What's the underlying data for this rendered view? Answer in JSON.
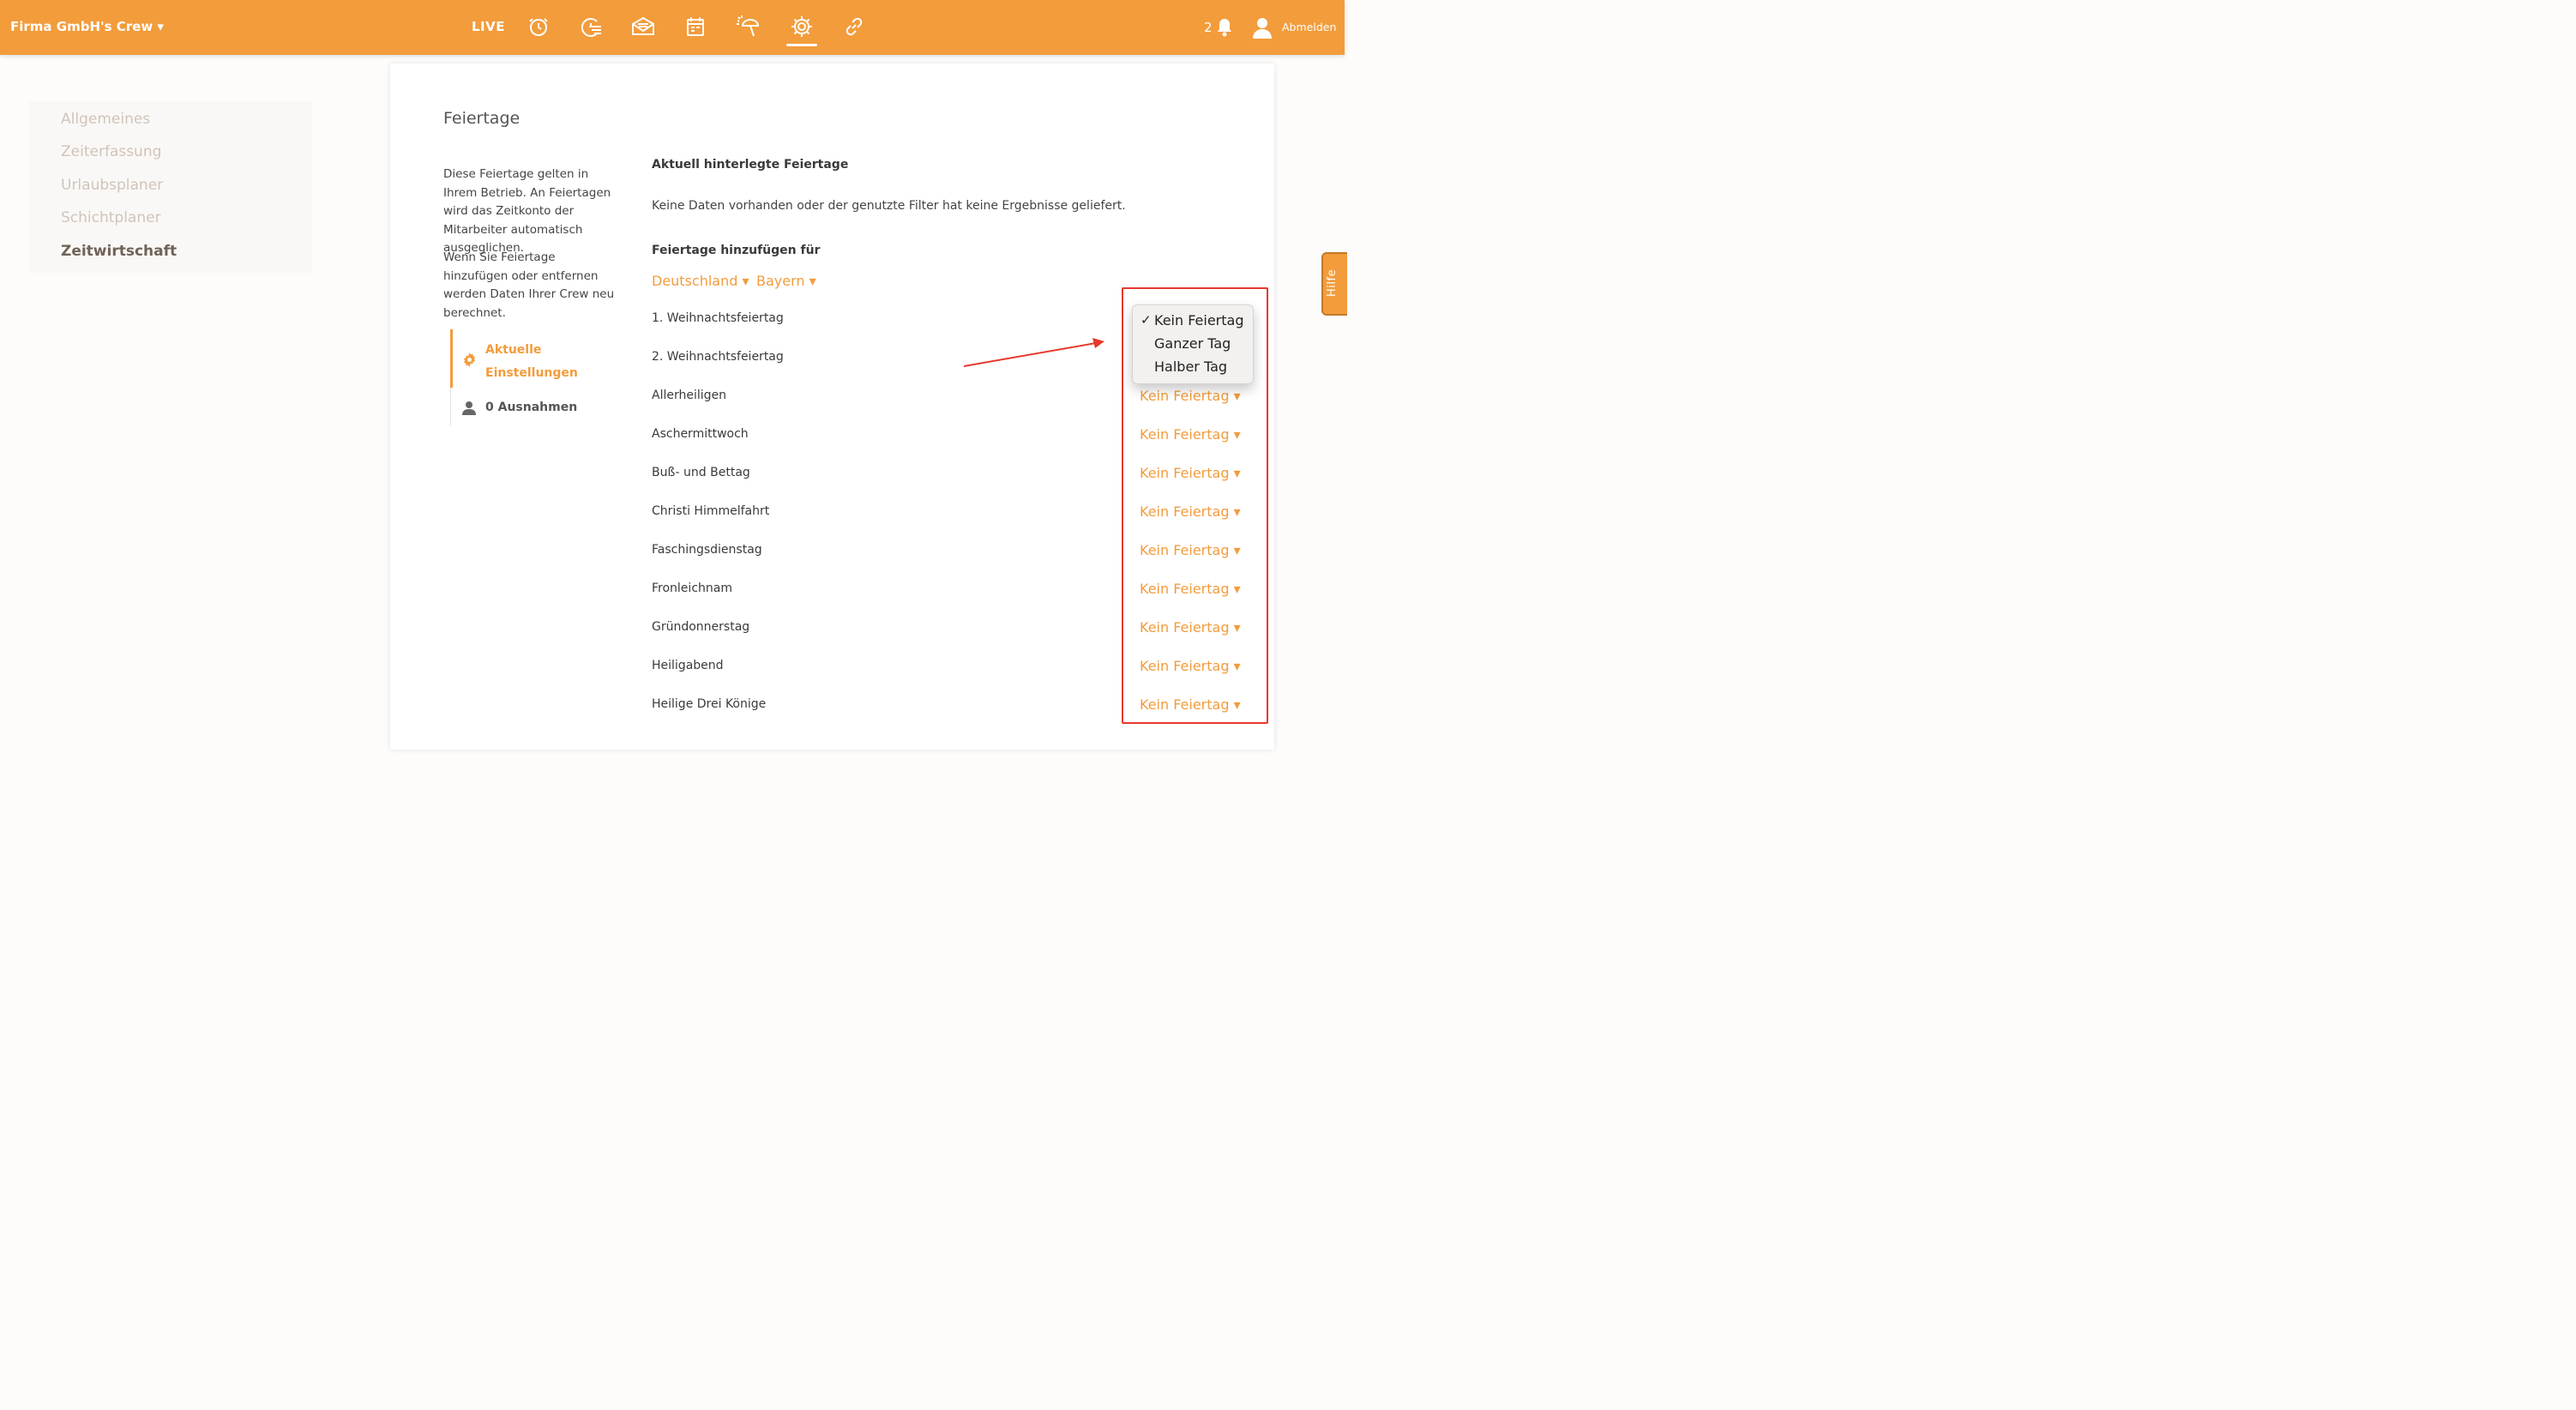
{
  "header": {
    "crew_label": "Firma GmbH's Crew ▾",
    "live_label": "LIVE",
    "nav_icons": [
      "clock-icon",
      "timesheet-icon",
      "inbox-icon",
      "calendar-icon",
      "vacation-umbrella-icon",
      "settings-gear-icon",
      "link-icon"
    ],
    "active_nav": "settings-gear-icon",
    "notification_count": "2",
    "logout_label": "Abmelden"
  },
  "sidebar": {
    "items": [
      {
        "label": "Allgemeines"
      },
      {
        "label": "Zeiterfassung"
      },
      {
        "label": "Urlaubsplaner"
      },
      {
        "label": "Schichtplaner"
      },
      {
        "label": "Zeitwirtschaft"
      }
    ],
    "active": "Zeitwirtschaft"
  },
  "main": {
    "title": "Feiertage",
    "description_1": "Diese Feiertage gelten in Ihrem Betrieb. An Feiertagen wird das Zeitkonto der Mitarbeiter automatisch ausgeglichen.",
    "description_2": "Wenn Sie Feiertage hinzufügen oder entfernen werden Daten Ihrer Crew neu berechnet.",
    "subnav": {
      "active_label": "Aktuelle Einstellungen",
      "other_label": "0 Ausnahmen"
    },
    "current_heading": "Aktuell hinterlegte Feiertage",
    "no_data_text": "Keine Daten vorhanden oder der genutzte Filter hat keine Ergebnisse geliefert.",
    "add_heading": "Feiertage hinzufügen für",
    "country_filter": "Deutschland ▾",
    "region_filter": "Bayern ▾",
    "holidays": [
      {
        "name": "1. Weihnachtsfeiertag",
        "value": ""
      },
      {
        "name": "2. Weihnachtsfeiertag",
        "value": ""
      },
      {
        "name": "Allerheiligen",
        "value": "Kein Feiertag ▾"
      },
      {
        "name": "Aschermittwoch",
        "value": "Kein Feiertag ▾"
      },
      {
        "name": "Buß- und Bettag",
        "value": "Kein Feiertag ▾"
      },
      {
        "name": "Christi Himmelfahrt",
        "value": "Kein Feiertag ▾"
      },
      {
        "name": "Faschingsdienstag",
        "value": "Kein Feiertag ▾"
      },
      {
        "name": "Fronleichnam",
        "value": "Kein Feiertag ▾"
      },
      {
        "name": "Gründonnerstag",
        "value": "Kein Feiertag ▾"
      },
      {
        "name": "Heiligabend",
        "value": "Kein Feiertag ▾"
      },
      {
        "name": "Heilige Drei Könige",
        "value": "Kein Feiertag ▾"
      }
    ],
    "dropdown_options": [
      {
        "check": "✓",
        "label": "Kein Feiertag"
      },
      {
        "check": "",
        "label": "Ganzer Tag"
      },
      {
        "check": "",
        "label": "Halber Tag"
      }
    ]
  },
  "help_label": "Hilfe",
  "colors": {
    "brand": "#f29c3c",
    "annotation": "#e8382c"
  }
}
